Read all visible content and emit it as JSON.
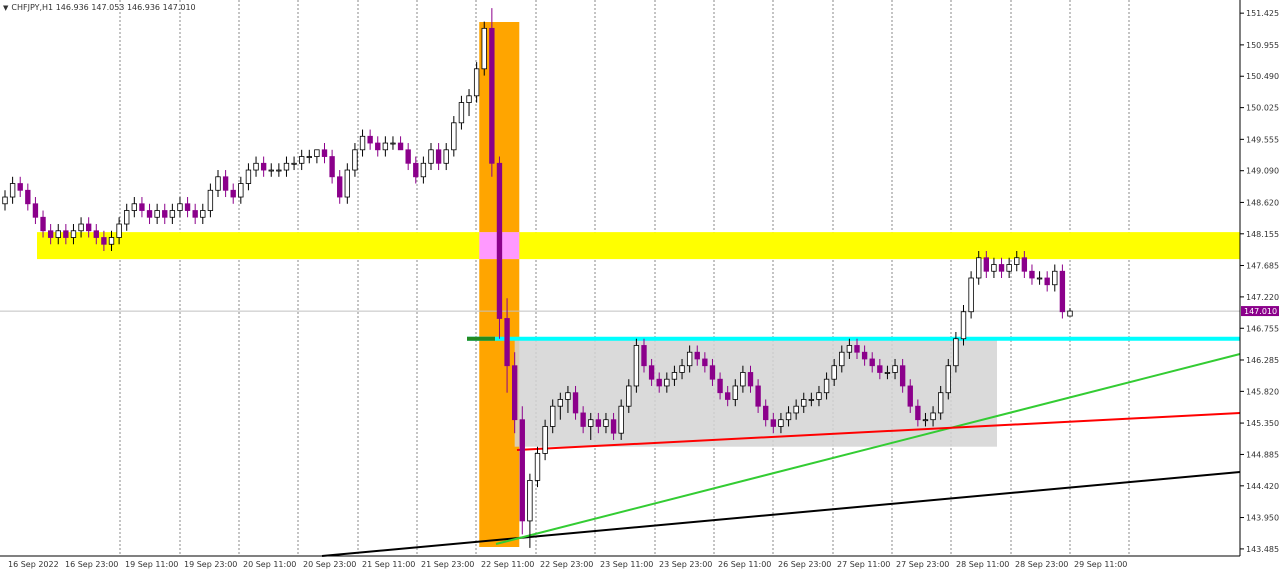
{
  "header": {
    "symbol_timeframe": "CHFJPY,H1",
    "ohlc": "146.936 147.053 146.936 147.010"
  },
  "colors": {
    "grid": "#888888",
    "bull_candle": "#ffffff",
    "bear_candle": "#8b008b",
    "candle_outline": "#000000",
    "orange_zone": "#ffa500",
    "yellow_zone": "#ffff00",
    "pink_overlap": "#ff99ff",
    "cyan_line": "#00ffff",
    "green_marker": "#228b22",
    "grey_range": "#d3d3d3",
    "red_trendline": "#ff0000",
    "green_trendline": "#33cc33",
    "black_trendline": "#000000",
    "current_price_bg": "#8b008b"
  },
  "chart_data": {
    "type": "candlestick",
    "title": "",
    "xlabel": "",
    "ylabel": "",
    "ylim": [
      143.38,
      151.62
    ],
    "y_ticks": [
      "151.425",
      "150.955",
      "150.490",
      "150.025",
      "149.555",
      "149.090",
      "148.620",
      "148.155",
      "147.685",
      "147.220",
      "146.755",
      "146.285",
      "145.820",
      "145.350",
      "144.885",
      "144.420",
      "143.950",
      "143.485"
    ],
    "x_ticks": [
      "16 Sep 2022",
      "16 Sep 23:00",
      "19 Sep 11:00",
      "19 Sep 23:00",
      "20 Sep 11:00",
      "20 Sep 23:00",
      "21 Sep 11:00",
      "21 Sep 23:00",
      "22 Sep 11:00",
      "22 Sep 23:00",
      "23 Sep 11:00",
      "23 Sep 23:00",
      "26 Sep 11:00",
      "26 Sep 23:00",
      "27 Sep 11:00",
      "27 Sep 23:00",
      "28 Sep 11:00",
      "28 Sep 23:00",
      "29 Sep 11:00"
    ],
    "current_price": "147.010",
    "candles": [
      [
        148.6,
        148.8,
        148.5,
        148.7
      ],
      [
        148.7,
        149.0,
        148.6,
        148.9
      ],
      [
        148.9,
        149.0,
        148.7,
        148.8
      ],
      [
        148.8,
        148.9,
        148.5,
        148.6
      ],
      [
        148.6,
        148.7,
        148.3,
        148.4
      ],
      [
        148.4,
        148.5,
        148.1,
        148.2
      ],
      [
        148.2,
        148.3,
        148.0,
        148.1
      ],
      [
        148.1,
        148.3,
        148.0,
        148.2
      ],
      [
        148.2,
        148.3,
        148.0,
        148.1
      ],
      [
        148.1,
        148.3,
        148.0,
        148.2
      ],
      [
        148.2,
        148.4,
        148.1,
        148.3
      ],
      [
        148.3,
        148.4,
        148.1,
        148.2
      ],
      [
        148.2,
        148.3,
        148.0,
        148.1
      ],
      [
        148.1,
        148.2,
        147.9,
        148.0
      ],
      [
        148.0,
        148.2,
        147.9,
        148.1
      ],
      [
        148.1,
        148.4,
        148.0,
        148.3
      ],
      [
        148.3,
        148.6,
        148.2,
        148.5
      ],
      [
        148.5,
        148.7,
        148.4,
        148.6
      ],
      [
        148.6,
        148.7,
        148.4,
        148.5
      ],
      [
        148.5,
        148.6,
        148.3,
        148.4
      ],
      [
        148.4,
        148.6,
        148.3,
        148.5
      ],
      [
        148.5,
        148.6,
        148.3,
        148.4
      ],
      [
        148.4,
        148.6,
        148.3,
        148.5
      ],
      [
        148.5,
        148.7,
        148.4,
        148.6
      ],
      [
        148.6,
        148.7,
        148.4,
        148.5
      ],
      [
        148.5,
        148.6,
        148.3,
        148.4
      ],
      [
        148.4,
        148.6,
        148.3,
        148.5
      ],
      [
        148.5,
        148.9,
        148.4,
        148.8
      ],
      [
        148.8,
        149.1,
        148.7,
        149.0
      ],
      [
        149.0,
        149.1,
        148.7,
        148.8
      ],
      [
        148.8,
        148.9,
        148.6,
        148.7
      ],
      [
        148.7,
        149.0,
        148.6,
        148.9
      ],
      [
        148.9,
        149.2,
        148.8,
        149.1
      ],
      [
        149.1,
        149.3,
        149.0,
        149.2
      ],
      [
        149.2,
        149.3,
        149.0,
        149.1
      ],
      [
        149.1,
        149.2,
        149.0,
        149.1
      ],
      [
        149.1,
        149.2,
        149.0,
        149.1
      ],
      [
        149.1,
        149.3,
        149.0,
        149.2
      ],
      [
        149.2,
        149.3,
        149.1,
        149.2
      ],
      [
        149.2,
        149.4,
        149.1,
        149.3
      ],
      [
        149.3,
        149.4,
        149.2,
        149.3
      ],
      [
        149.3,
        149.4,
        149.2,
        149.4
      ],
      [
        149.4,
        149.5,
        149.2,
        149.3
      ],
      [
        149.3,
        149.4,
        148.9,
        149.0
      ],
      [
        149.0,
        149.1,
        148.6,
        148.7
      ],
      [
        148.7,
        149.2,
        148.6,
        149.1
      ],
      [
        149.1,
        149.5,
        149.0,
        149.4
      ],
      [
        149.4,
        149.7,
        149.3,
        149.6
      ],
      [
        149.6,
        149.7,
        149.4,
        149.5
      ],
      [
        149.5,
        149.6,
        149.3,
        149.4
      ],
      [
        149.4,
        149.6,
        149.3,
        149.5
      ],
      [
        149.5,
        149.6,
        149.4,
        149.5
      ],
      [
        149.5,
        149.6,
        149.4,
        149.4
      ],
      [
        149.4,
        149.5,
        149.1,
        149.2
      ],
      [
        149.2,
        149.3,
        148.9,
        149.0
      ],
      [
        149.0,
        149.3,
        148.9,
        149.2
      ],
      [
        149.2,
        149.5,
        149.1,
        149.4
      ],
      [
        149.4,
        149.5,
        149.1,
        149.2
      ],
      [
        149.2,
        149.5,
        149.1,
        149.4
      ],
      [
        149.4,
        149.9,
        149.3,
        149.8
      ],
      [
        149.8,
        150.2,
        149.7,
        150.1
      ],
      [
        150.1,
        150.3,
        149.9,
        150.2
      ],
      [
        150.2,
        150.7,
        150.1,
        150.6
      ],
      [
        150.6,
        151.3,
        150.5,
        151.2
      ],
      [
        151.2,
        151.5,
        149.0,
        149.2
      ],
      [
        149.2,
        149.3,
        146.6,
        146.9
      ],
      [
        146.9,
        147.2,
        145.8,
        146.2
      ],
      [
        146.2,
        146.4,
        145.2,
        145.4
      ],
      [
        145.4,
        145.6,
        143.7,
        143.9
      ],
      [
        143.9,
        144.6,
        143.5,
        144.5
      ],
      [
        144.5,
        145.0,
        144.4,
        144.9
      ],
      [
        144.9,
        145.4,
        144.8,
        145.3
      ],
      [
        145.3,
        145.7,
        145.2,
        145.6
      ],
      [
        145.6,
        145.8,
        145.4,
        145.7
      ],
      [
        145.7,
        145.9,
        145.5,
        145.8
      ],
      [
        145.8,
        145.9,
        145.4,
        145.5
      ],
      [
        145.5,
        145.6,
        145.2,
        145.3
      ],
      [
        145.3,
        145.5,
        145.1,
        145.4
      ],
      [
        145.4,
        145.5,
        145.2,
        145.3
      ],
      [
        145.3,
        145.5,
        145.2,
        145.4
      ],
      [
        145.4,
        145.5,
        145.1,
        145.2
      ],
      [
        145.2,
        145.7,
        145.1,
        145.6
      ],
      [
        145.6,
        146.0,
        145.5,
        145.9
      ],
      [
        145.9,
        146.6,
        145.8,
        146.5
      ],
      [
        146.5,
        146.6,
        146.1,
        146.2
      ],
      [
        146.2,
        146.3,
        145.9,
        146.0
      ],
      [
        146.0,
        146.1,
        145.8,
        145.9
      ],
      [
        145.9,
        146.1,
        145.8,
        146.0
      ],
      [
        146.0,
        146.2,
        145.9,
        146.1
      ],
      [
        146.1,
        146.3,
        146.0,
        146.2
      ],
      [
        146.2,
        146.5,
        146.1,
        146.4
      ],
      [
        146.4,
        146.5,
        146.2,
        146.3
      ],
      [
        146.3,
        146.4,
        146.1,
        146.2
      ],
      [
        146.2,
        146.3,
        145.9,
        146.0
      ],
      [
        146.0,
        146.1,
        145.7,
        145.8
      ],
      [
        145.8,
        145.9,
        145.6,
        145.7
      ],
      [
        145.7,
        146.0,
        145.6,
        145.9
      ],
      [
        145.9,
        146.2,
        145.8,
        146.1
      ],
      [
        146.1,
        146.2,
        145.8,
        145.9
      ],
      [
        145.9,
        146.0,
        145.5,
        145.6
      ],
      [
        145.6,
        145.7,
        145.3,
        145.4
      ],
      [
        145.4,
        145.5,
        145.2,
        145.3
      ],
      [
        145.3,
        145.5,
        145.2,
        145.4
      ],
      [
        145.4,
        145.6,
        145.3,
        145.5
      ],
      [
        145.5,
        145.7,
        145.4,
        145.6
      ],
      [
        145.6,
        145.8,
        145.5,
        145.7
      ],
      [
        145.7,
        145.8,
        145.6,
        145.7
      ],
      [
        145.7,
        145.9,
        145.6,
        145.8
      ],
      [
        145.8,
        146.1,
        145.7,
        146.0
      ],
      [
        146.0,
        146.3,
        145.9,
        146.2
      ],
      [
        146.2,
        146.5,
        146.1,
        146.4
      ],
      [
        146.4,
        146.6,
        146.3,
        146.5
      ],
      [
        146.5,
        146.6,
        146.3,
        146.4
      ],
      [
        146.4,
        146.5,
        146.2,
        146.3
      ],
      [
        146.3,
        146.4,
        146.1,
        146.2
      ],
      [
        146.2,
        146.3,
        146.0,
        146.1
      ],
      [
        146.1,
        146.2,
        146.0,
        146.1
      ],
      [
        146.1,
        146.3,
        146.0,
        146.2
      ],
      [
        146.2,
        146.3,
        145.8,
        145.9
      ],
      [
        145.9,
        146.0,
        145.5,
        145.6
      ],
      [
        145.6,
        145.7,
        145.3,
        145.4
      ],
      [
        145.4,
        145.5,
        145.3,
        145.4
      ],
      [
        145.4,
        145.6,
        145.3,
        145.5
      ],
      [
        145.5,
        145.9,
        145.4,
        145.8
      ],
      [
        145.8,
        146.3,
        145.7,
        146.2
      ],
      [
        146.2,
        146.7,
        146.1,
        146.6
      ],
      [
        146.6,
        147.1,
        146.5,
        147.0
      ],
      [
        147.0,
        147.6,
        146.9,
        147.5
      ],
      [
        147.5,
        147.9,
        147.4,
        147.8
      ],
      [
        147.8,
        147.9,
        147.5,
        147.6
      ],
      [
        147.6,
        147.8,
        147.5,
        147.7
      ],
      [
        147.7,
        147.8,
        147.5,
        147.6
      ],
      [
        147.6,
        147.8,
        147.5,
        147.7
      ],
      [
        147.7,
        147.9,
        147.6,
        147.8
      ],
      [
        147.8,
        147.9,
        147.5,
        147.6
      ],
      [
        147.6,
        147.7,
        147.4,
        147.5
      ],
      [
        147.5,
        147.6,
        147.4,
        147.5
      ],
      [
        147.5,
        147.6,
        147.3,
        147.4
      ],
      [
        147.4,
        147.7,
        147.3,
        147.6
      ],
      [
        147.6,
        147.7,
        146.9,
        147.0
      ],
      [
        146.936,
        147.053,
        146.936,
        147.01
      ]
    ]
  }
}
